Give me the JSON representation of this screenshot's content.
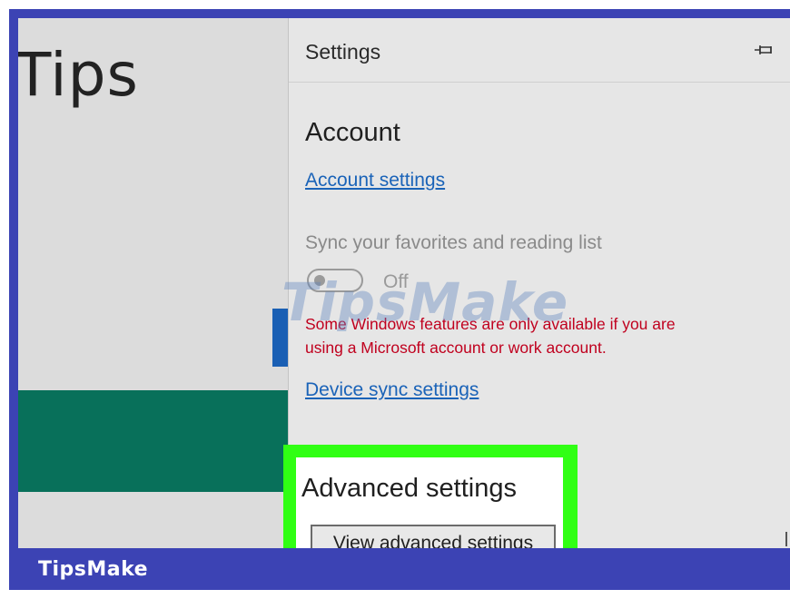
{
  "app": {
    "title": "Tips"
  },
  "settings_pane": {
    "title": "Settings",
    "pin_icon": "pin-icon",
    "account_heading": "Account",
    "account_settings_link": "Account settings",
    "sync_label": "Sync your favorites and reading list",
    "sync_toggle": {
      "state_label": "Off",
      "on": false
    },
    "warning_line1": "Some Windows features are only available if you are",
    "warning_line2": "using a Microsoft account or work account.",
    "device_sync_link": "Device sync settings",
    "advanced_heading": "Advanced settings",
    "view_advanced_button": "View advanced settings"
  },
  "watermark": "TipsMake",
  "footer": {
    "brand": "TipsMake"
  },
  "colors": {
    "frame_blue": "#3c43b4",
    "highlight_green": "#30ff14",
    "app_green": "#08705a",
    "link_blue": "#1a63b8",
    "warning_red": "#c0001e",
    "pane_bg": "#e6e6e6"
  }
}
